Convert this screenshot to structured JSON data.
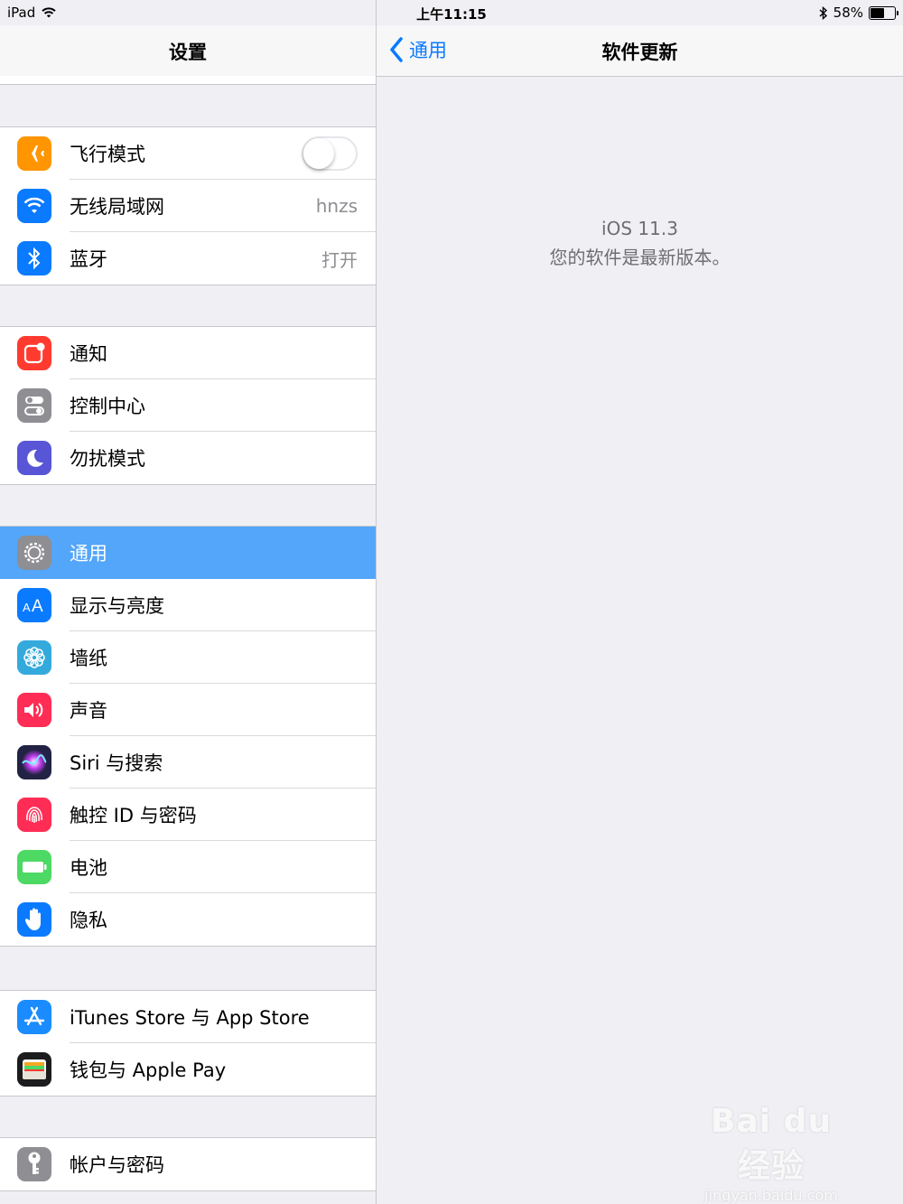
{
  "status_bar": {
    "device": "iPad",
    "time": "上午11:15",
    "battery_percent": "58%",
    "battery_level": 0.58
  },
  "sidebar": {
    "title": "设置",
    "groups": [
      [
        {
          "label": "飞行模式",
          "icon": "airplane-icon",
          "color": "#ff9500",
          "toggle": false
        },
        {
          "label": "无线局域网",
          "icon": "wifi-icon",
          "color": "#0a7aff",
          "value": "hnzs"
        },
        {
          "label": "蓝牙",
          "icon": "bluetooth-icon",
          "color": "#0a7aff",
          "value": "打开"
        }
      ],
      [
        {
          "label": "通知",
          "icon": "notifications-icon",
          "color": "#ff3b30"
        },
        {
          "label": "控制中心",
          "icon": "control-center-icon",
          "color": "#8e8e93"
        },
        {
          "label": "勿扰模式",
          "icon": "moon-icon",
          "color": "#5856d6"
        }
      ],
      [
        {
          "label": "通用",
          "icon": "gear-icon",
          "color": "#8e8e93",
          "selected": true
        },
        {
          "label": "显示与亮度",
          "icon": "display-aa-icon",
          "color": "#0a7aff"
        },
        {
          "label": "墙纸",
          "icon": "wallpaper-flower-icon",
          "color": "#34aadc"
        },
        {
          "label": "声音",
          "icon": "speaker-icon",
          "color": "#ff2d55"
        },
        {
          "label": "Siri 与搜索",
          "icon": "siri-icon",
          "color": "#222244"
        },
        {
          "label": "触控 ID 与密码",
          "icon": "fingerprint-icon",
          "color": "#ff2d55"
        },
        {
          "label": "电池",
          "icon": "battery-icon",
          "color": "#4cd964"
        },
        {
          "label": "隐私",
          "icon": "hand-icon",
          "color": "#0a7aff"
        }
      ],
      [
        {
          "label": "iTunes Store 与 App Store",
          "icon": "app-store-icon",
          "color": "#1a8cff"
        },
        {
          "label": "钱包与 Apple Pay",
          "icon": "wallet-icon",
          "color": "#1c1c1e"
        }
      ],
      [
        {
          "label": "帐户与密码",
          "icon": "key-icon",
          "color": "#8e8e93"
        }
      ]
    ]
  },
  "detail": {
    "back_label": "通用",
    "title": "软件更新",
    "version": "iOS 11.3",
    "message": "您的软件是最新版本。"
  },
  "watermark": {
    "brand": "Bai du 经验",
    "url": "jingyan.baidu.com"
  },
  "colors": {
    "accent": "#0a7aff",
    "selected_row": "#53a6f9",
    "background": "#efeff4"
  }
}
